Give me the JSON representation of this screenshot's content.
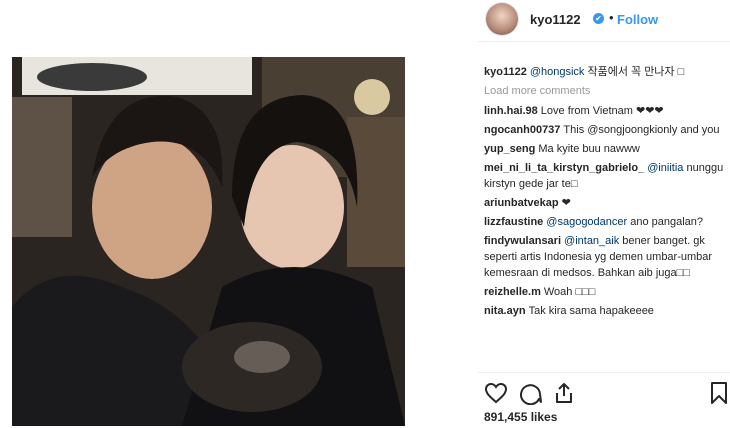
{
  "header": {
    "username": "kyo1122",
    "separator": "•",
    "follow_label": "Follow",
    "verified_glyph": "✔"
  },
  "caption": {
    "user": "kyo1122",
    "mention": "@hongsick",
    "text": " 작품에서 꼭 만나자 □"
  },
  "load_more": "Load more comments",
  "comments": [
    {
      "user": "linh.hai.98",
      "mention": "",
      "text": "Love from Vietnam ❤❤❤"
    },
    {
      "user": "ngocanh00737",
      "mention": "",
      "text": "This @songjoongkionly and you"
    },
    {
      "user": "yup_seng",
      "mention": "",
      "text": "Ma kyite buu nawww"
    },
    {
      "user": "mei_ni_li_ta_kirstyn_gabrielo_",
      "mention": "@iniitia",
      "text": " nunggu kirstyn gede jar te□"
    },
    {
      "user": "ariunbatvekap",
      "mention": "",
      "text": "❤"
    },
    {
      "user": "lizzfaustine",
      "mention": "@sagogodancer",
      "text": " ano pangalan?"
    },
    {
      "user": "findywulansari",
      "mention": "@intan_aik",
      "text": " bener banget. gk seperti artis Indonesia yg demen umbar-umbar kemesraan di medsos. Bahkan aib juga□□"
    },
    {
      "user": "reizhelle.m",
      "mention": "",
      "text": "Woah □□□"
    },
    {
      "user": "nita.ayn",
      "mention": "",
      "text": "Tak kira sama hapakeeee"
    }
  ],
  "likes": "891,455 likes",
  "icons": [
    "heart-icon",
    "comment-icon",
    "share-icon",
    "bookmark-icon"
  ],
  "colors": {
    "link": "#3897f0",
    "mention": "#003569",
    "muted": "#999999"
  }
}
